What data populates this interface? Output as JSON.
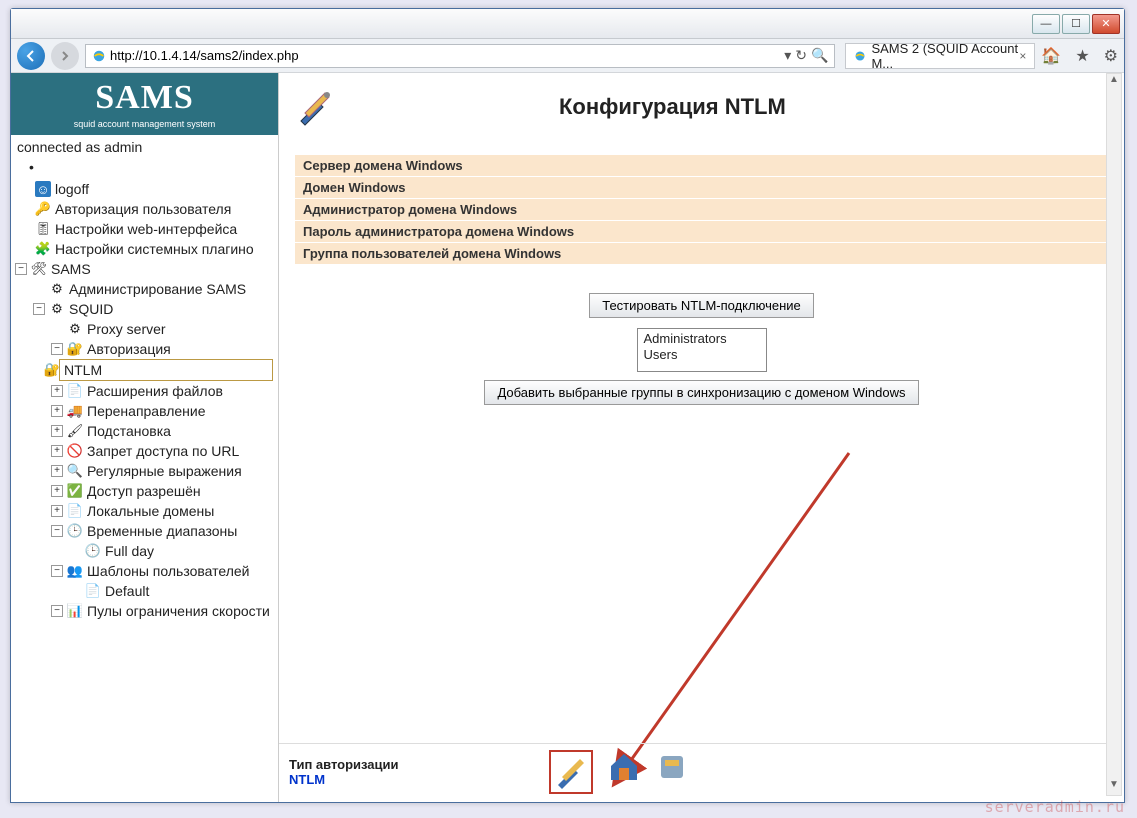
{
  "browser": {
    "url": "http://10.1.4.14/sams2/index.php",
    "tab_title": "SAMS 2 (SQUID Account M..."
  },
  "sidebar": {
    "logo": "SAMS",
    "logo_sub": "squid account management system",
    "connected": "connected as admin",
    "items": {
      "logoff": "logoff",
      "auth_user": "Авторизация пользователя",
      "web_settings": "Настройки web-интерфейса",
      "sys_plugins": "Настройки системных плагино",
      "sams": "SAMS",
      "admin_sams": "Администрирование SAMS",
      "squid": "SQUID",
      "proxy": "Proxy server",
      "authz": "Авторизация",
      "ntlm": "NTLM",
      "file_ext": "Расширения файлов",
      "redirect": "Перенаправление",
      "subst": "Подстановка",
      "deny_url": "Запрет доступа по URL",
      "regex": "Регулярные выражения",
      "allowed": "Доступ разрешён",
      "local_dom": "Локальные домены",
      "time_ranges": "Временные диапазоны",
      "full_day": "Full day",
      "user_tmpl": "Шаблоны пользователей",
      "default": "Default",
      "speed_pools": "Пулы ограничения скорости"
    }
  },
  "main": {
    "title": "Конфигурация NTLM",
    "fields": [
      "Сервер домена Windows",
      "Домен Windows",
      "Администратор домена Windows",
      "Пароль администратора домена Windows",
      "Группа пользователей домена Windows"
    ],
    "btn_test": "Тестировать NTLM-подключение",
    "listbox": [
      "Administrators",
      "Users"
    ],
    "btn_add": "Добавить выбранные группы в синхронизацию с доменом Windows"
  },
  "footer": {
    "label": "Тип авторизации",
    "value": "NTLM"
  },
  "watermark": "serveradmin.ru"
}
